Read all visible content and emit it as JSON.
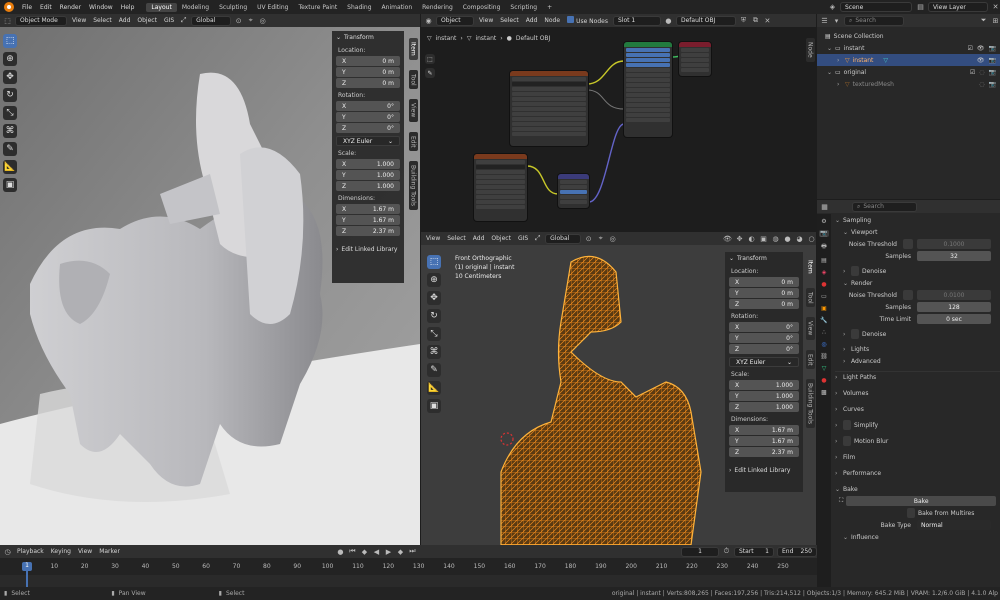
{
  "topbar": {
    "menus": [
      "File",
      "Edit",
      "Render",
      "Window",
      "Help"
    ],
    "workspaces": [
      "Layout",
      "Modeling",
      "Sculpting",
      "UV Editing",
      "Texture Paint",
      "Shading",
      "Animation",
      "Rendering",
      "Compositing",
      "Scripting"
    ],
    "active_workspace": "Layout",
    "scene": "Scene",
    "view_layer": "View Layer"
  },
  "viewport_left": {
    "mode": "Object Mode",
    "menus": [
      "View",
      "Select",
      "Add",
      "Object",
      "GIS"
    ],
    "orientation": "Global",
    "tabs": [
      "Item",
      "Tool",
      "View",
      "Edit",
      "Building Tools"
    ],
    "active_tab": "Item",
    "transform_title": "Transform",
    "location_label": "Location:",
    "location": [
      {
        "axis": "X",
        "value": "0 m"
      },
      {
        "axis": "Y",
        "value": "0 m"
      },
      {
        "axis": "Z",
        "value": "0 m"
      }
    ],
    "rotation_label": "Rotation:",
    "rotation": [
      {
        "axis": "X",
        "value": "0°"
      },
      {
        "axis": "Y",
        "value": "0°"
      },
      {
        "axis": "Z",
        "value": "0°"
      }
    ],
    "rotation_mode": "XYZ Euler",
    "scale_label": "Scale:",
    "scale": [
      {
        "axis": "X",
        "value": "1.000"
      },
      {
        "axis": "Y",
        "value": "1.000"
      },
      {
        "axis": "Z",
        "value": "1.000"
      }
    ],
    "dimensions_label": "Dimensions:",
    "dimensions": [
      {
        "axis": "X",
        "value": "1.67 m"
      },
      {
        "axis": "Y",
        "value": "1.67 m"
      },
      {
        "axis": "Z",
        "value": "2.37 m"
      }
    ],
    "linked_library": "Edit Linked Library"
  },
  "node_editor": {
    "type": "Object",
    "menus": [
      "View",
      "Select",
      "Add",
      "Node"
    ],
    "use_nodes": "Use Nodes",
    "slot": "Slot 1",
    "material": "Default OBJ",
    "breadcrumb": [
      "instant",
      "instant",
      "Default OBJ"
    ]
  },
  "viewport_right": {
    "menus": [
      "View",
      "Select",
      "Add",
      "Object",
      "GIS"
    ],
    "orientation": "Global",
    "overlay_title": "Front Orthographic",
    "overlay_object": "(1) original | instant",
    "overlay_scale": "10 Centimeters",
    "tabs": [
      "Item",
      "Tool",
      "View",
      "Edit",
      "Building Tools"
    ],
    "active_tab": "Item",
    "transform_title": "Transform",
    "location_label": "Location:",
    "location": [
      {
        "axis": "X",
        "value": "0 m"
      },
      {
        "axis": "Y",
        "value": "0 m"
      },
      {
        "axis": "Z",
        "value": "0 m"
      }
    ],
    "rotation_label": "Rotation:",
    "rotation": [
      {
        "axis": "X",
        "value": "0°"
      },
      {
        "axis": "Y",
        "value": "0°"
      },
      {
        "axis": "Z",
        "value": "0°"
      }
    ],
    "rotation_mode": "XYZ Euler",
    "scale_label": "Scale:",
    "scale": [
      {
        "axis": "X",
        "value": "1.000"
      },
      {
        "axis": "Y",
        "value": "1.000"
      },
      {
        "axis": "Z",
        "value": "1.000"
      }
    ],
    "dimensions_label": "Dimensions:",
    "dimensions": [
      {
        "axis": "X",
        "value": "1.67 m"
      },
      {
        "axis": "Y",
        "value": "1.67 m"
      },
      {
        "axis": "Z",
        "value": "2.37 m"
      }
    ],
    "linked_library": "Edit Linked Library"
  },
  "outliner": {
    "search_placeholder": "Search",
    "items": [
      {
        "label": "Scene Collection",
        "depth": 0,
        "active": false
      },
      {
        "label": "instant",
        "depth": 1,
        "active": false
      },
      {
        "label": "instant",
        "depth": 2,
        "active": true
      },
      {
        "label": "original",
        "depth": 1,
        "active": false
      },
      {
        "label": "texturedMesh",
        "depth": 2,
        "active": false
      }
    ]
  },
  "properties": {
    "search_placeholder": "Search",
    "sampling": "Sampling",
    "viewport": "Viewport",
    "noise_threshold_label": "Noise Threshold",
    "viewport_noise_threshold": "0.1000",
    "samples_label": "Samples",
    "viewport_samples": "32",
    "denoise": "Denoise",
    "render": "Render",
    "render_noise_threshold": "0.0100",
    "render_samples": "128",
    "time_limit_label": "Time Limit",
    "time_limit": "0 sec",
    "render_denoise": "Denoise",
    "lights": "Lights",
    "advanced": "Advanced",
    "sections": [
      "Light Paths",
      "Volumes",
      "Curves",
      "Simplify",
      "Motion Blur",
      "Film",
      "Performance"
    ],
    "bake": "Bake",
    "bake_button": "Bake",
    "bake_from_multires": "Bake from Multires",
    "bake_type_label": "Bake Type",
    "bake_type": "Normal",
    "influence": "Influence"
  },
  "timeline": {
    "menus": [
      "Playback",
      "Keying",
      "View",
      "Marker"
    ],
    "current_frame": "1",
    "start_label": "Start",
    "start": "1",
    "end_label": "End",
    "end": "250",
    "ticks": [
      "1",
      "10",
      "20",
      "30",
      "40",
      "50",
      "60",
      "70",
      "80",
      "90",
      "100",
      "110",
      "120",
      "130",
      "140",
      "150",
      "160",
      "170",
      "180",
      "190",
      "200",
      "210",
      "220",
      "230",
      "240",
      "250"
    ],
    "playhead": "1"
  },
  "statusbar": {
    "hints": [
      "Select",
      "Pan View",
      "Select"
    ],
    "stats": "original | instant | Verts:808,265 | Faces:197,256 | Tris:214,512 | Objects:1/3 | Memory: 645.2 MiB | VRAM: 1.2/6.0 GiB | 4.1.0 Alp"
  },
  "colors": {
    "accent": "#4772b3",
    "wire": "#f08a1c",
    "active_text": "#ffb36b",
    "logo": "#e87d0d"
  }
}
